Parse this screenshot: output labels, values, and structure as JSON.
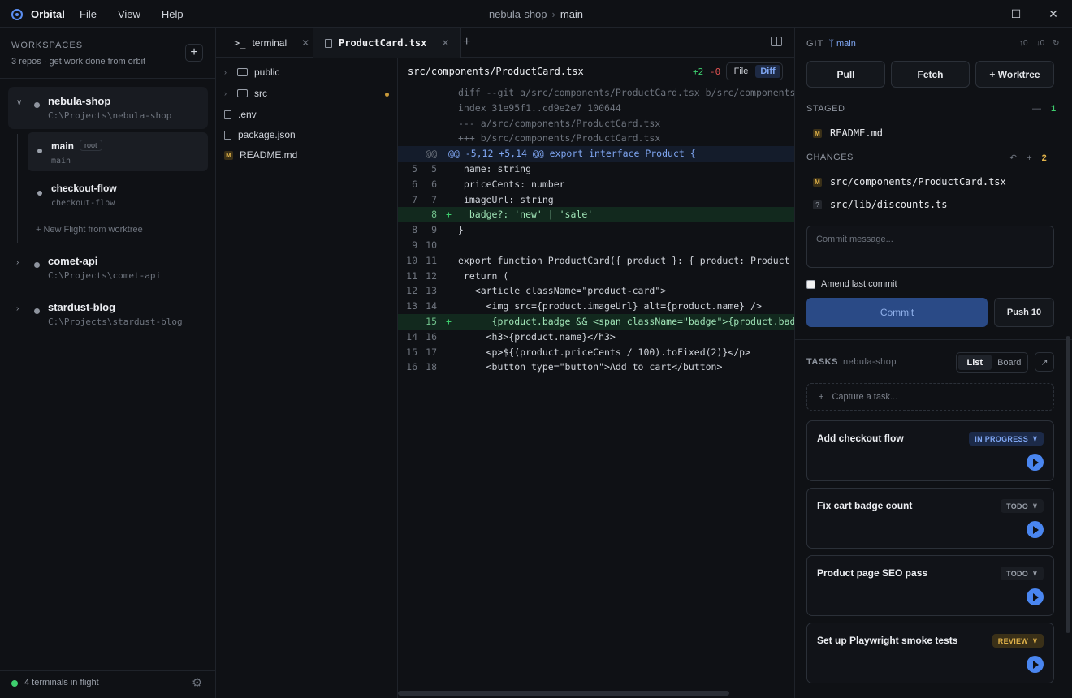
{
  "app": {
    "name": "Orbital",
    "menu": [
      "File",
      "View",
      "Help"
    ],
    "breadcrumb": {
      "repo": "nebula-shop",
      "sep": "›",
      "branch": "main"
    }
  },
  "window": {
    "minimize": "—",
    "maximize": "☐",
    "close": "✕"
  },
  "sidebar": {
    "title": "WORKSPACES",
    "subtitle": "3 repos · get work done from orbit",
    "add": "+",
    "repos": [
      {
        "name": "nebula-shop",
        "path": "C:\\Projects\\nebula-shop",
        "expanded": true,
        "branches": [
          {
            "name": "main",
            "badge": "root",
            "sub": "main"
          },
          {
            "name": "checkout-flow",
            "sub": "checkout-flow"
          }
        ],
        "new_flight": "New Flight from worktree"
      },
      {
        "name": "comet-api",
        "path": "C:\\Projects\\comet-api"
      },
      {
        "name": "stardust-blog",
        "path": "C:\\Projects\\stardust-blog"
      }
    ],
    "footer": "4 terminals in flight"
  },
  "tabs": [
    {
      "label": "terminal",
      "icon": ">_"
    },
    {
      "label": "ProductCard.tsx"
    }
  ],
  "files": [
    "public",
    "src",
    ".env",
    "package.json",
    "README.md"
  ],
  "file_badge": "M",
  "diff": {
    "path": "src/components/ProductCard.tsx",
    "added": "+2",
    "removed": "-0",
    "mode_file": "File",
    "mode_diff": "Diff",
    "lines": [
      {
        "o": "",
        "n": "",
        "m": "",
        "t": "diff --git a/src/components/ProductCard.tsx b/src/components/ProductCard.tsx",
        "k": "meta"
      },
      {
        "o": "",
        "n": "",
        "m": "",
        "t": "index 31e95f1..cd9e2e7 100644",
        "k": "meta"
      },
      {
        "o": "",
        "n": "",
        "m": "",
        "t": "--- a/src/components/ProductCard.tsx",
        "k": "meta"
      },
      {
        "o": "",
        "n": "",
        "m": "",
        "t": "+++ b/src/components/ProductCard.tsx",
        "k": "meta"
      },
      {
        "o": "",
        "n": "@@",
        "m": "",
        "t": "@@ -5,12 +5,14 @@ export interface Product {",
        "k": "hunk"
      },
      {
        "o": "5",
        "n": "5",
        "m": "",
        "t": " name: string",
        "k": ""
      },
      {
        "o": "6",
        "n": "6",
        "m": "",
        "t": " priceCents: number",
        "k": ""
      },
      {
        "o": "7",
        "n": "7",
        "m": "",
        "t": " imageUrl: string",
        "k": ""
      },
      {
        "o": "",
        "n": "8",
        "m": "+",
        "t": "  badge?: 'new' | 'sale'",
        "k": "add"
      },
      {
        "o": "8",
        "n": "9",
        "m": "",
        "t": "}",
        "k": ""
      },
      {
        "o": "9",
        "n": "10",
        "m": "",
        "t": "",
        "k": ""
      },
      {
        "o": "10",
        "n": "11",
        "m": "",
        "t": "export function ProductCard({ product }: { product: Product }) {",
        "k": ""
      },
      {
        "o": "11",
        "n": "12",
        "m": "",
        "t": " return (",
        "k": ""
      },
      {
        "o": "12",
        "n": "13",
        "m": "",
        "t": "   <article className=\"product-card\">",
        "k": ""
      },
      {
        "o": "13",
        "n": "14",
        "m": "",
        "t": "     <img src={product.imageUrl} alt={product.name} />",
        "k": ""
      },
      {
        "o": "",
        "n": "15",
        "m": "+",
        "t": "      {product.badge && <span className=\"badge\">{product.badge}</span>}",
        "k": "add"
      },
      {
        "o": "14",
        "n": "16",
        "m": "",
        "t": "     <h3>{product.name}</h3>",
        "k": ""
      },
      {
        "o": "15",
        "n": "17",
        "m": "",
        "t": "     <p>${(product.priceCents / 100).toFixed(2)}</p>",
        "k": ""
      },
      {
        "o": "16",
        "n": "18",
        "m": "",
        "t": "     <button type=\"button\">Add to cart</button>",
        "k": ""
      }
    ]
  },
  "git": {
    "title": "GIT",
    "branch": "main",
    "icons": [
      "↑0",
      "↓0",
      "↻"
    ],
    "buttons": {
      "pull": "Pull",
      "fetch": "Fetch",
      "worktree": "Worktree"
    },
    "staged": {
      "title": "STAGED",
      "count": "1",
      "action": "—",
      "files": [
        {
          "badge": "M",
          "path": "README.md"
        }
      ]
    },
    "changes": {
      "title": "CHANGES",
      "count": "2",
      "discard": "↶",
      "stage": "+",
      "files": [
        {
          "badge": "M",
          "path": "src/components/ProductCard.tsx"
        },
        {
          "badge": "?",
          "path": "src/lib/discounts.ts"
        }
      ]
    },
    "commit_placeholder": "Commit message...",
    "amend": "Amend last commit",
    "commit": "Commit",
    "push": "Push 10"
  },
  "tasks": {
    "title": "TASKS",
    "repo": "nebula-shop",
    "view_list": "List",
    "view_board": "Board",
    "capture": "Capture a task...",
    "items": [
      {
        "title": "Add checkout flow",
        "status": "IN PROGRESS",
        "kind": "prog"
      },
      {
        "title": "Fix cart badge count",
        "status": "TODO",
        "kind": "todo"
      },
      {
        "title": "Product page SEO pass",
        "status": "TODO",
        "kind": "todo"
      },
      {
        "title": "Set up Playwright smoke tests",
        "status": "REVIEW",
        "kind": "review"
      }
    ]
  },
  "colors": {
    "accent": "#4a86f0",
    "added": "#3ecf6e",
    "removed": "#e05252",
    "modified": "#e0b24a"
  }
}
